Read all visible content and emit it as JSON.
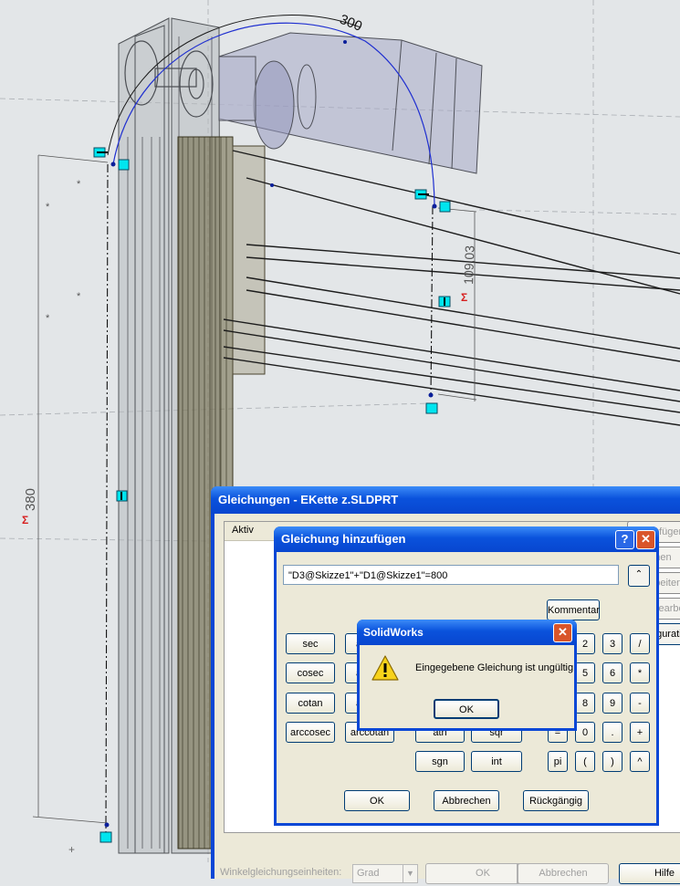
{
  "cad": {
    "dim_radius": "300",
    "dim_vertical": "109,03",
    "dim_height": "380",
    "star": "*"
  },
  "eq_window": {
    "title": "Gleichungen - EKette z.SLDPRT",
    "column_header": "Aktiv",
    "side_buttons": [
      "Hinzufügen",
      "Löschen",
      "Bearbeiten",
      "Alle bearbeiten",
      "Konfiguration"
    ],
    "footer_label": "Winkelgleichungseinheiten:",
    "footer_select": "Grad",
    "footer_ok": "OK",
    "footer_cancel": "Abbrechen",
    "footer_help": "Hilfe"
  },
  "add_dialog": {
    "title": "Gleichung hinzufügen",
    "help_glyph": "?",
    "close_glyph": "✕",
    "equation": "\"D3@Skizze1\"+\"D1@Skizze1\"=800",
    "collapse_glyph": "⌃",
    "comment_label": "Kommentar",
    "keys": {
      "sec": "sec",
      "cosec": "cosec",
      "cotan": "cotan",
      "arccosec": "arccosec",
      "arccotan": "arccotan",
      "atn": "atn",
      "sqr": "sqr",
      "sgn": "sgn",
      "int": "int",
      "n2": "2",
      "n3": "3",
      "div": "/",
      "n5": "5",
      "n6": "6",
      "mul": "*",
      "n8": "8",
      "n9": "9",
      "minus": "-",
      "eq": "=",
      "n0": "0",
      "dot": ".",
      "plus": "+",
      "pi": "pi",
      "lparen": "(",
      "rparen": ")",
      "pow": "^"
    },
    "ok_label": "OK",
    "cancel_label": "Abbrechen",
    "undo_label": "Rückgängig"
  },
  "error_box": {
    "title": "SolidWorks",
    "close_glyph": "✕",
    "message": "Eingegebene Gleichung ist ungültig",
    "ok_label": "OK"
  },
  "colors": {
    "titlebar": "#0a52dc",
    "dialog_bg": "#ece9d8",
    "viewport_bg": "#e3e6e8",
    "sketch_blue": "#1f2fd0",
    "handle_cyan": "#00e5ef"
  }
}
